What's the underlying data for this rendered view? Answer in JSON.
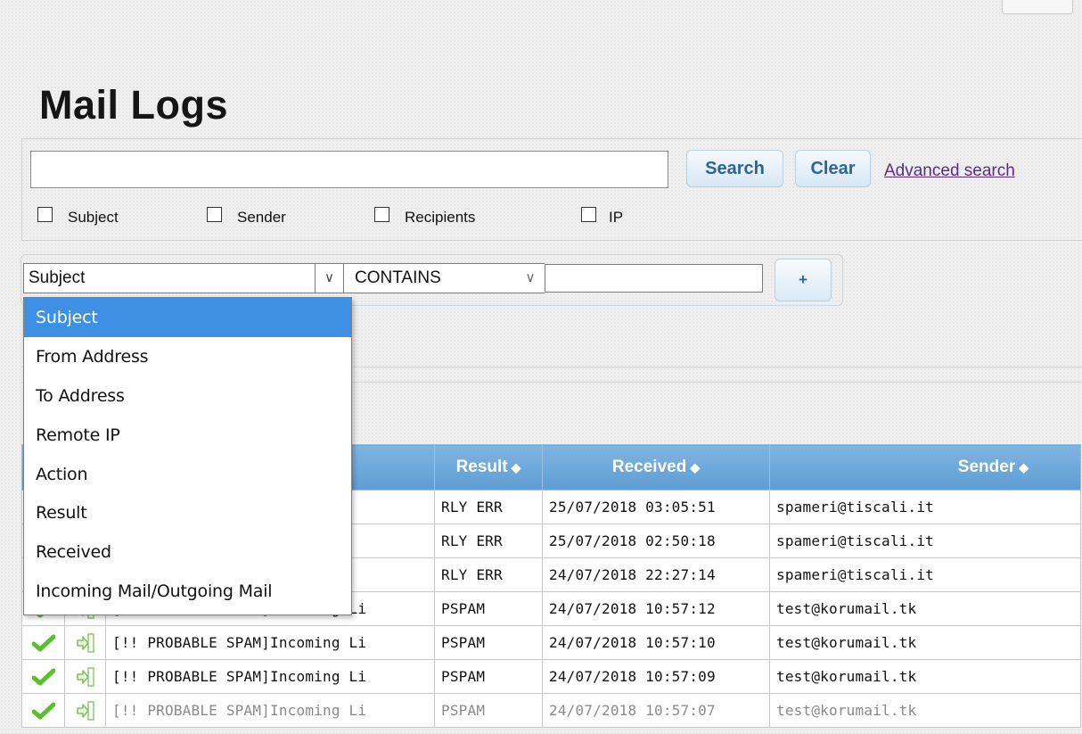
{
  "page": {
    "title": "Mail Logs"
  },
  "search": {
    "value": "",
    "search_label": "Search",
    "clear_label": "Clear",
    "advanced_label": "Advanced search",
    "filters": [
      "Subject",
      "Sender",
      "Recipients",
      "IP"
    ]
  },
  "advanced": {
    "field_value": "Subject",
    "operator_value": "CONTAINS",
    "value": "",
    "add_label": "+"
  },
  "dropdown": {
    "options": [
      "Subject",
      "From Address",
      "To Address",
      "Remote IP",
      "Action",
      "Result",
      "Received",
      "Incoming Mail/Outgoing Mail"
    ],
    "selected": "Subject"
  },
  "table": {
    "headers": {
      "result": "Result",
      "received": "Received",
      "sender": "Sender"
    },
    "rows": [
      {
        "subject": "",
        "result": "RLY ERR",
        "received": "25/07/2018 03:05:51",
        "sender": "spameri@tiscali.it"
      },
      {
        "subject": "",
        "result": "RLY ERR",
        "received": "25/07/2018 02:50:18",
        "sender": "spameri@tiscali.it"
      },
      {
        "subject": "",
        "result": "RLY ERR",
        "received": "24/07/2018 22:27:14",
        "sender": "spameri@tiscali.it"
      },
      {
        "subject": "[!! PROBABLE SPAM]Incoming Li",
        "result": "PSPAM",
        "received": "24/07/2018 10:57:12",
        "sender": "test@korumail.tk"
      },
      {
        "subject": "[!! PROBABLE SPAM]Incoming Li",
        "result": "PSPAM",
        "received": "24/07/2018 10:57:10",
        "sender": "test@korumail.tk"
      },
      {
        "subject": "[!! PROBABLE SPAM]Incoming Li",
        "result": "PSPAM",
        "received": "24/07/2018 10:57:09",
        "sender": "test@korumail.tk"
      },
      {
        "subject": "[!! PROBABLE SPAM]Incoming Li",
        "result": "PSPAM",
        "received": "24/07/2018 10:57:07",
        "sender": "test@korumail.tk"
      }
    ]
  },
  "icons": {
    "status": "checkmark-icon",
    "direction": "incoming-arrow-icon",
    "sort": "sort-icon",
    "chevron": "chevron-down-icon"
  },
  "colors": {
    "header_blue": "#6aa6da",
    "selected_option": "#3d90e4",
    "button_text": "#2c6496",
    "link": "#5a2a91",
    "check_green": "#5bbf2c"
  }
}
